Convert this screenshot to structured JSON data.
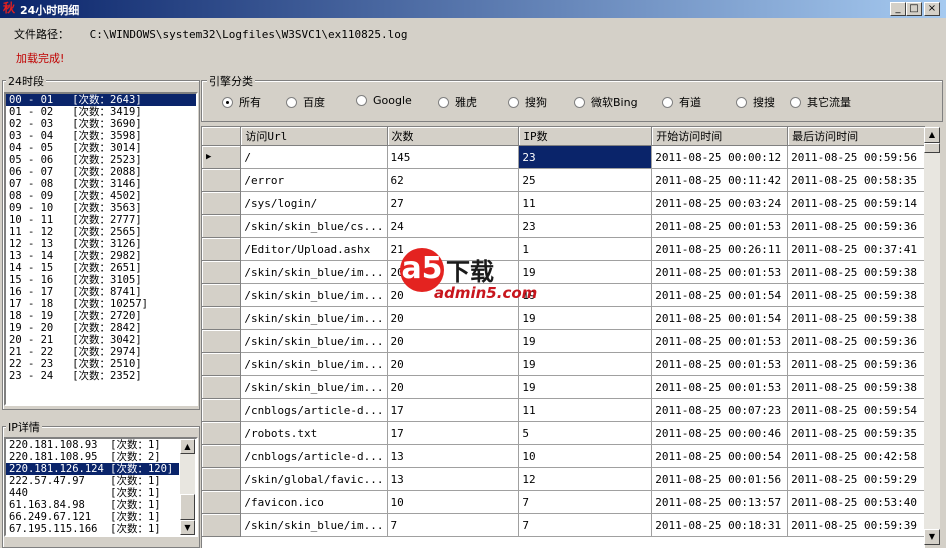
{
  "window": {
    "title": "24小时明细",
    "app_icon": "秋",
    "min_label": "_",
    "max_label": "□",
    "close_label": "×"
  },
  "path": {
    "label": "文件路径：",
    "value": "C:\\WINDOWS\\system32\\Logfiles\\W3SVC1\\ex110825.log"
  },
  "status": "加载完成!",
  "hours": {
    "caption": "24时段",
    "items": [
      "00 - 01   [次数：2643]",
      "01 - 02   [次数：3419]",
      "02 - 03   [次数：3690]",
      "03 - 04   [次数：3598]",
      "04 - 05   [次数：3014]",
      "05 - 06   [次数：2523]",
      "06 - 07   [次数：2088]",
      "07 - 08   [次数：3146]",
      "08 - 09   [次数：4502]",
      "09 - 10   [次数：3563]",
      "10 - 11   [次数：2777]",
      "11 - 12   [次数：2565]",
      "12 - 13   [次数：3126]",
      "13 - 14   [次数：2982]",
      "14 - 15   [次数：2651]",
      "15 - 16   [次数：3105]",
      "16 - 17   [次数：8741]",
      "17 - 18   [次数：10257]",
      "18 - 19   [次数：2720]",
      "19 - 20   [次数：2842]",
      "20 - 21   [次数：3042]",
      "21 - 22   [次数：2974]",
      "22 - 23   [次数：2510]",
      "23 - 24   [次数：2352]"
    ],
    "selected_index": 0
  },
  "ip": {
    "caption": "IP详情",
    "items": [
      "220.181.108.93  [次数：1]",
      "220.181.108.95  [次数：2]",
      "220.181.126.124 [次数：120]",
      "222.57.47.97    [次数：1]",
      "440             [次数：1]",
      "61.163.84.98    [次数：1]",
      "66.249.67.121   [次数：1]",
      "67.195.115.166  [次数：1]"
    ],
    "selected_index": 2
  },
  "engines": {
    "caption": "引擎分类",
    "options": [
      "所有",
      "百度",
      "Google",
      "雅虎",
      "搜狗",
      "微软Bing",
      "有道",
      "搜搜",
      "其它流量"
    ],
    "selected_index": 0
  },
  "table": {
    "columns": [
      "访问Url",
      "次数",
      "IP数",
      "开始访问时间",
      "最后访问时间"
    ],
    "current_row_marker": "▶",
    "rows": [
      [
        "/",
        "145",
        "23",
        "2011-08-25 00:00:12",
        "2011-08-25 00:59:56"
      ],
      [
        "/error",
        "62",
        "25",
        "2011-08-25 00:11:42",
        "2011-08-25 00:58:35"
      ],
      [
        "/sys/login/",
        "27",
        "11",
        "2011-08-25 00:03:24",
        "2011-08-25 00:59:14"
      ],
      [
        "/skin/skin_blue/cs...",
        "24",
        "23",
        "2011-08-25 00:01:53",
        "2011-08-25 00:59:36"
      ],
      [
        "/Editor/Upload.ashx",
        "21",
        "1",
        "2011-08-25 00:26:11",
        "2011-08-25 00:37:41"
      ],
      [
        "/skin/skin_blue/im...",
        "20",
        "19",
        "2011-08-25 00:01:53",
        "2011-08-25 00:59:38"
      ],
      [
        "/skin/skin_blue/im...",
        "20",
        "19",
        "2011-08-25 00:01:54",
        "2011-08-25 00:59:38"
      ],
      [
        "/skin/skin_blue/im...",
        "20",
        "19",
        "2011-08-25 00:01:54",
        "2011-08-25 00:59:38"
      ],
      [
        "/skin/skin_blue/im...",
        "20",
        "19",
        "2011-08-25 00:01:53",
        "2011-08-25 00:59:36"
      ],
      [
        "/skin/skin_blue/im...",
        "20",
        "19",
        "2011-08-25 00:01:53",
        "2011-08-25 00:59:36"
      ],
      [
        "/skin/skin_blue/im...",
        "20",
        "19",
        "2011-08-25 00:01:53",
        "2011-08-25 00:59:38"
      ],
      [
        "/cnblogs/article-d...",
        "17",
        "11",
        "2011-08-25 00:07:23",
        "2011-08-25 00:59:54"
      ],
      [
        "/robots.txt",
        "17",
        "5",
        "2011-08-25 00:00:46",
        "2011-08-25 00:59:35"
      ],
      [
        "/cnblogs/article-d...",
        "13",
        "10",
        "2011-08-25 00:00:54",
        "2011-08-25 00:42:58"
      ],
      [
        "/skin/global/favic...",
        "13",
        "12",
        "2011-08-25 00:01:56",
        "2011-08-25 00:59:29"
      ],
      [
        "/favicon.ico",
        "10",
        "7",
        "2011-08-25 00:13:57",
        "2011-08-25 00:53:40"
      ],
      [
        "/skin/skin_blue/im...",
        "7",
        "7",
        "2011-08-25 00:18:31",
        "2011-08-25 00:59:39"
      ]
    ],
    "selected_row": 0,
    "selected_col": 2
  },
  "watermark": {
    "logo": "a5",
    "text": "下载",
    "url": "admin5.com"
  },
  "colors": {
    "selection": "#0a246a",
    "status_text": "#c00000",
    "face": "#d4d0c8"
  }
}
